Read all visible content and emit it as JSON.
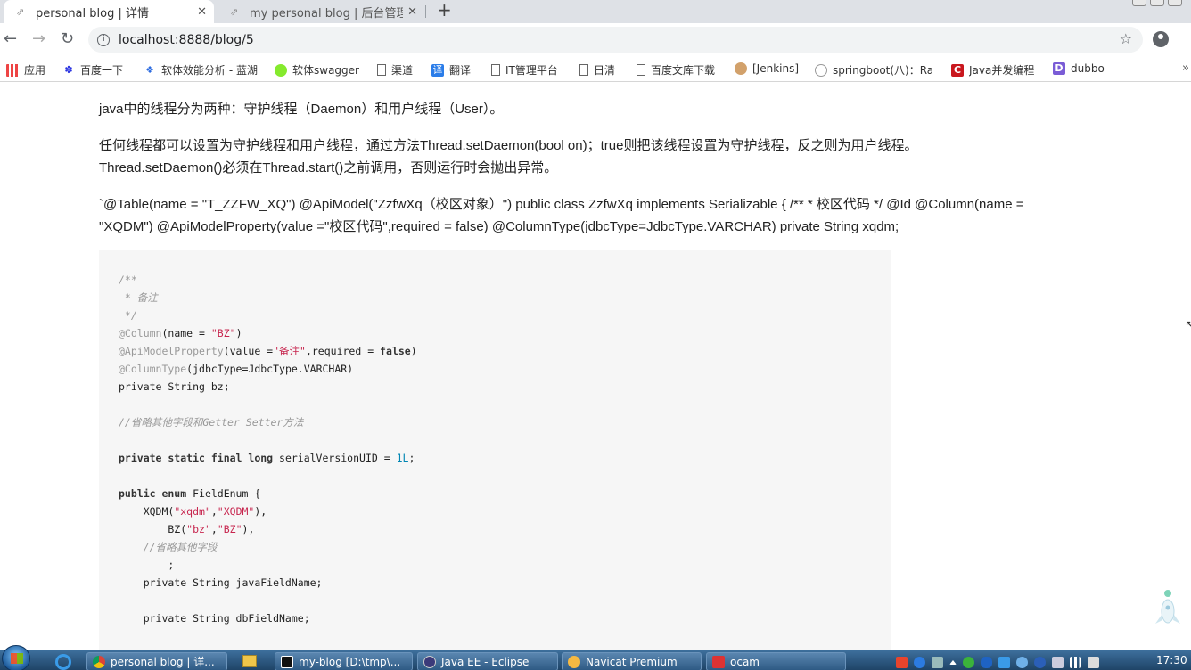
{
  "browser": {
    "tabs": [
      {
        "title": "personal blog | 详情",
        "active": true
      },
      {
        "title": "my personal blog | 后台管理系统",
        "active": false
      }
    ],
    "new_tab_label": "+",
    "url": "localhost:8888/blog/5",
    "bookmarks": [
      {
        "label": "应用",
        "icon": "apps-grid-icon"
      },
      {
        "label": "百度一下",
        "icon": "baidu-paw-icon"
      },
      {
        "label": "软体效能分析 - 蓝湖",
        "icon": "lanhu-icon"
      },
      {
        "label": "软体swagger",
        "icon": "swagger-icon"
      },
      {
        "label": "渠道",
        "icon": "page-icon"
      },
      {
        "label": "翻译",
        "icon": "translate-icon"
      },
      {
        "label": "IT管理平台",
        "icon": "page-icon"
      },
      {
        "label": "日清",
        "icon": "page-icon"
      },
      {
        "label": "百度文库下载",
        "icon": "page-icon"
      },
      {
        "label": "[Jenkins]",
        "icon": "jenkins-icon"
      },
      {
        "label": "springboot(八)：Ra",
        "icon": "spring-icon"
      },
      {
        "label": "Java并发编程",
        "icon": "csdn-icon"
      },
      {
        "label": "dubbo",
        "icon": "dubbo-icon"
      }
    ],
    "bookmarks_more": "»"
  },
  "article": {
    "p1": "java中的线程分为两种：守护线程（Daemon）和用户线程（User）。",
    "p2_line1": "任何线程都可以设置为守护线程和用户线程，通过方法Thread.setDaemon(bool on)；true则把该线程设置为守护线程，反之则为用户线程。",
    "p2_line2": "Thread.setDaemon()必须在Thread.start()之前调用，否则运行时会抛出异常。",
    "p3_line1": "`@Table(name = \"T_ZZFW_XQ\") @ApiModel(\"ZzfwXq（校区对象）\") public class ZzfwXq implements Serializable { /** * 校区代码 */ @Id @Column(name =",
    "p3_line2": "\"XQDM\") @ApiModelProperty(value =\"校区代码\",required = false) @ColumnType(jdbcType=JdbcType.VARCHAR) private String xqdm;",
    "code": {
      "l1": "/**",
      "l2": " * 备注",
      "l3": " */",
      "l4_anno": "@Column",
      "l4_a": "(name = ",
      "l4_str": "\"BZ\"",
      "l4_b": ")",
      "l5_anno": "@ApiModelProperty",
      "l5_a": "(value =",
      "l5_str": "\"备注\"",
      "l5_b": ",required = ",
      "l5_kw": "false",
      "l5_c": ")",
      "l6_anno": "@ColumnType",
      "l6_a": "(jdbcType=JdbcType.VARCHAR)",
      "l7": "private String bz;",
      "l9": "//省略其他字段和Getter Setter方法",
      "l11_kw": "private static final long",
      "l11_a": " serialVersionUID = ",
      "l11_num": "1L",
      "l11_b": ";",
      "l13_kw": "public enum",
      "l13_a": " FieldEnum {",
      "l14_a": "    XQDM(",
      "l14_s1": "\"xqdm\"",
      "l14_b": ",",
      "l14_s2": "\"XQDM\"",
      "l14_c": "),",
      "l15_a": "        BZ(",
      "l15_s1": "\"bz\"",
      "l15_b": ",",
      "l15_s2": "\"BZ\"",
      "l15_c": "),",
      "l16": "    //省略其他字段",
      "l17": "        ;",
      "l18": "    private String javaFieldName;",
      "l20": "    private String dbFieldName;"
    }
  },
  "taskbar": {
    "items": [
      {
        "label": "personal blog | 详..."
      },
      {
        "label": "my-blog [D:\\tmp\\..."
      },
      {
        "label": "Java EE - Eclipse"
      },
      {
        "label": "Navicat Premium"
      },
      {
        "label": "ocam"
      }
    ],
    "clock": "17:30"
  }
}
